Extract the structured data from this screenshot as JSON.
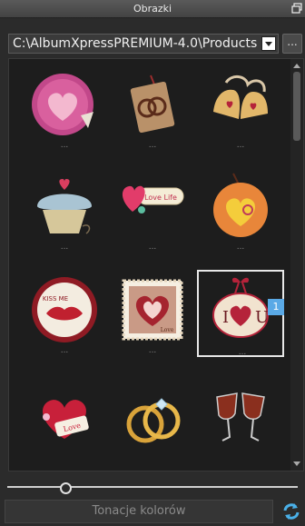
{
  "titlebar": {
    "title": "Obrazki",
    "restore_icon": "restore-window-icon"
  },
  "pathbar": {
    "path": "C:\\AlbumXpressPREMIUM-4.0\\Products",
    "browse_label": "...",
    "dropdown_icon": "chevron-down-icon"
  },
  "gallery": {
    "items": [
      {
        "icon": "heart-sticker-icon",
        "caption": "..."
      },
      {
        "icon": "rings-tag-icon",
        "caption": "..."
      },
      {
        "icon": "wedding-bells-icon",
        "caption": "..."
      },
      {
        "icon": "cupcake-heart-icon",
        "caption": "..."
      },
      {
        "icon": "love-life-tag-icon",
        "caption": "...",
        "label": "Love Life"
      },
      {
        "icon": "orange-heart-tag-icon",
        "caption": "..."
      },
      {
        "icon": "kiss-me-lips-icon",
        "caption": "...",
        "label": "KISS ME"
      },
      {
        "icon": "love-stamp-icon",
        "caption": "...",
        "label": "Love"
      },
      {
        "icon": "i-love-u-icon",
        "caption": "...",
        "badge": "1"
      },
      {
        "icon": "love-heart-card-icon",
        "caption": "",
        "label": "Love"
      },
      {
        "icon": "wedding-rings-icon",
        "caption": ""
      },
      {
        "icon": "wine-glasses-icon",
        "caption": ""
      }
    ],
    "selected_index": 8,
    "accent": "#5aa9e6"
  },
  "zoom": {
    "value_percent": 20
  },
  "bottombar": {
    "tone_label": "Tonacje kolorów",
    "refresh_icon": "refresh-icon"
  }
}
